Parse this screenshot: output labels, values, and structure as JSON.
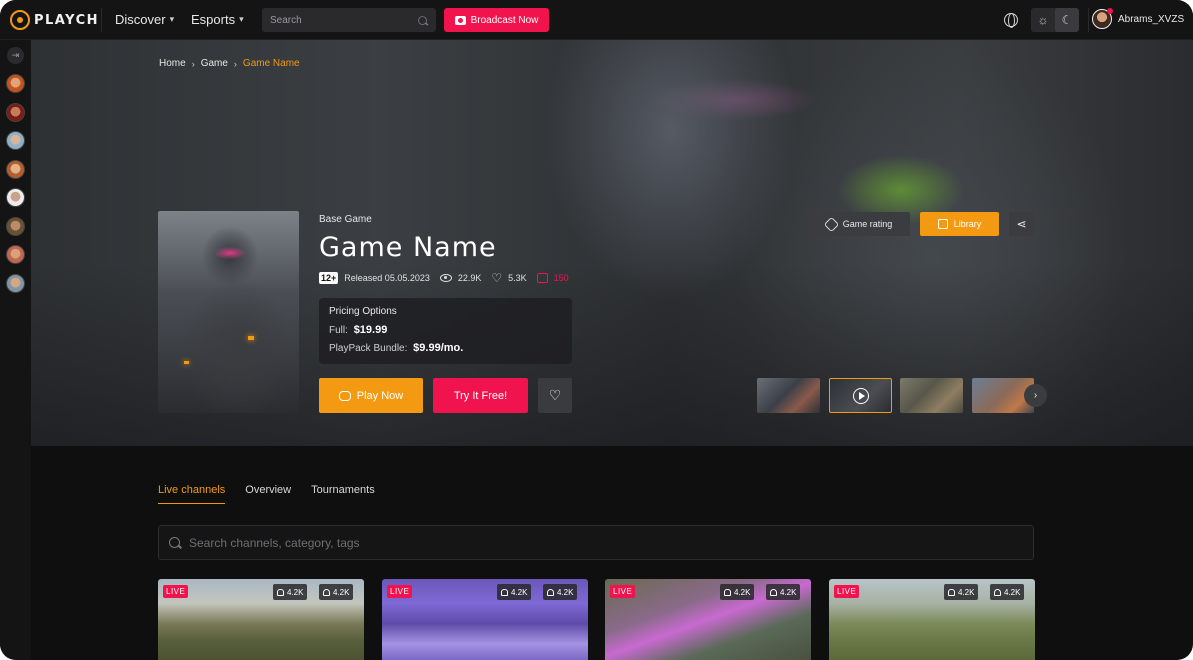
{
  "topbar": {
    "logo_text": "PLAYCH",
    "nav": [
      {
        "label": "Discover",
        "chevron": "chevron-down-icon"
      },
      {
        "label": "Esports",
        "chevron": "chevron-down-icon"
      }
    ],
    "search_placeholder": "Search",
    "broadcast_label": "Broadcast Now",
    "theme_light_icon": "☼",
    "theme_dark_icon": "☾",
    "username": "Abrams_XVZS"
  },
  "colors": {
    "accent_orange": "#f39a12",
    "accent_red": "#f0134d",
    "bg": "#0f0f10"
  },
  "breadcrumb": [
    {
      "label": "Home"
    },
    {
      "label": "Game"
    },
    {
      "label": "Game Name",
      "current": true
    }
  ],
  "game": {
    "type_label": "Base Game",
    "title": "Game Name",
    "age_rating": "12+",
    "released": "Released 05.05.2023",
    "views": "22.9K",
    "likes": "5.3K",
    "streams": "150",
    "pricing": {
      "heading": "Pricing Options",
      "full_label": "Full:",
      "full_price": "$19.99",
      "bundle_label": "PlayPack Bundle:",
      "bundle_price": "$9.99/mo."
    },
    "actions": {
      "play": "Play Now",
      "try": "Try It Free!",
      "rating": "Game rating",
      "library": "Library"
    }
  },
  "tabs": [
    {
      "label": "Live channels",
      "active": true
    },
    {
      "label": "Overview"
    },
    {
      "label": "Tournaments"
    }
  ],
  "channel_search_placeholder": "Search channels, category, tags",
  "channels": [
    {
      "badge": "LIVE",
      "notify": "4.2K",
      "viewers": "4.2K"
    },
    {
      "badge": "LIVE",
      "notify": "4.2K",
      "viewers": "4.2K"
    },
    {
      "badge": "LIVE",
      "notify": "4.2K",
      "viewers": "4.2K"
    },
    {
      "badge": "LIVE",
      "notify": "4.2K",
      "viewers": "4.2K"
    }
  ]
}
